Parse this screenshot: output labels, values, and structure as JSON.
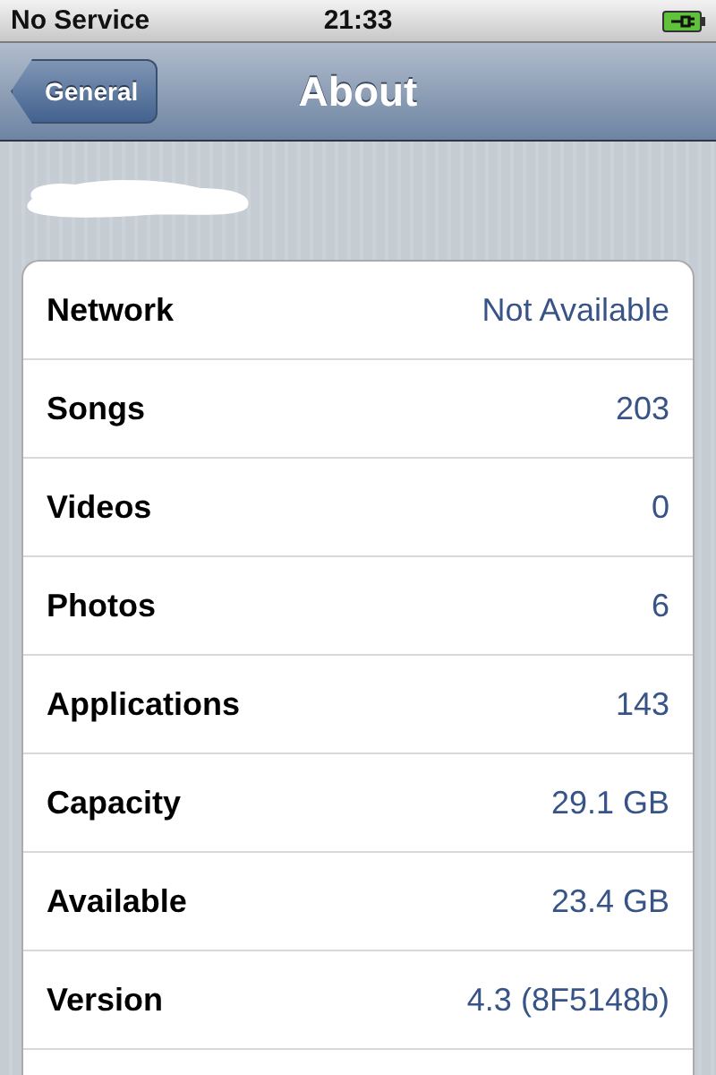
{
  "status_bar": {
    "carrier": "No Service",
    "time": "21:33"
  },
  "nav_bar": {
    "back_button": "General",
    "title": "About"
  },
  "rows": [
    {
      "label": "Network",
      "value": "Not Available"
    },
    {
      "label": "Songs",
      "value": "203"
    },
    {
      "label": "Videos",
      "value": "0"
    },
    {
      "label": "Photos",
      "value": "6"
    },
    {
      "label": "Applications",
      "value": "143"
    },
    {
      "label": "Capacity",
      "value": "29.1 GB"
    },
    {
      "label": "Available",
      "value": "23.4 GB"
    },
    {
      "label": "Version",
      "value": "4.3 (8F5148b)"
    }
  ]
}
